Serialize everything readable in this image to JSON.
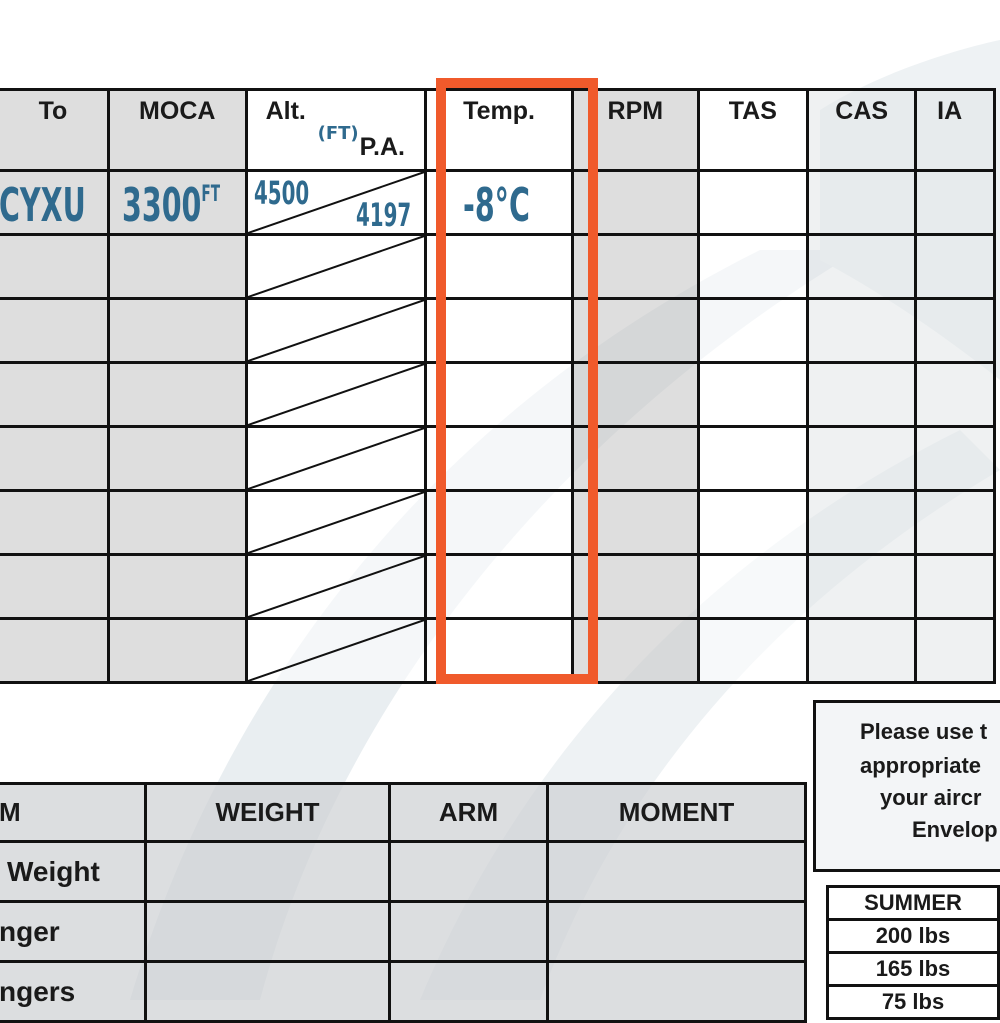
{
  "nav_log": {
    "headers": [
      "To",
      "MOCA",
      "Alt.",
      "Temp.",
      "RPM",
      "TAS",
      "CAS",
      "IA"
    ],
    "alt_unit": "(FT)",
    "alt_sub": "P.A.",
    "row1": {
      "to": "CYXU",
      "moca": "3300",
      "moca_unit": "FT",
      "alt": "4500",
      "pa": "4197",
      "temp": "-8°C"
    },
    "empty_rows": 7
  },
  "weight_balance": {
    "headers": [
      "M",
      "WEIGHT",
      "ARM",
      "MOMENT"
    ],
    "rows": [
      "Weight",
      "nger",
      "ngers"
    ]
  },
  "note": {
    "lines": [
      "Please use t",
      "appropriate",
      "your aircr",
      "Envelop"
    ]
  },
  "summer_table": {
    "header": "SUMMER",
    "values": [
      "200 lbs",
      "165 lbs",
      "75 lbs"
    ]
  },
  "highlight": {
    "color": "#f05a2b",
    "target": "Temp."
  }
}
